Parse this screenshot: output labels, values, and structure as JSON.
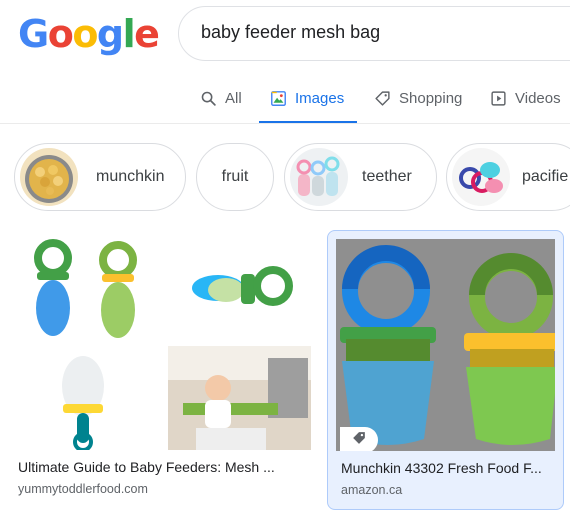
{
  "logo": {
    "letters": [
      "G",
      "o",
      "o",
      "g",
      "l",
      "e"
    ],
    "colors": [
      "#4285F4",
      "#EA4335",
      "#FBBC05",
      "#4285F4",
      "#34A853",
      "#EA4335"
    ]
  },
  "search": {
    "query": "baby feeder mesh bag"
  },
  "tabs": [
    {
      "label": "All",
      "icon": "search-icon",
      "active": false
    },
    {
      "label": "Images",
      "icon": "image-icon",
      "active": true
    },
    {
      "label": "Shopping",
      "icon": "tag-icon",
      "active": false
    },
    {
      "label": "Videos",
      "icon": "play-icon",
      "active": false
    }
  ],
  "chips": [
    {
      "label": "munchkin"
    },
    {
      "label": "fruit"
    },
    {
      "label": "teether"
    },
    {
      "label": "pacifie"
    }
  ],
  "results": [
    {
      "title": "Ultimate Guide to Baby Feeders: Mesh ...",
      "source": "yummytoddlerfood.com",
      "selected": false
    },
    {
      "title": "Munchkin 43302 Fresh Food F...",
      "source": "amazon.ca",
      "selected": true
    }
  ],
  "colors": {
    "accent": "#1a73e8",
    "selected_bg": "#e8f0fe"
  }
}
